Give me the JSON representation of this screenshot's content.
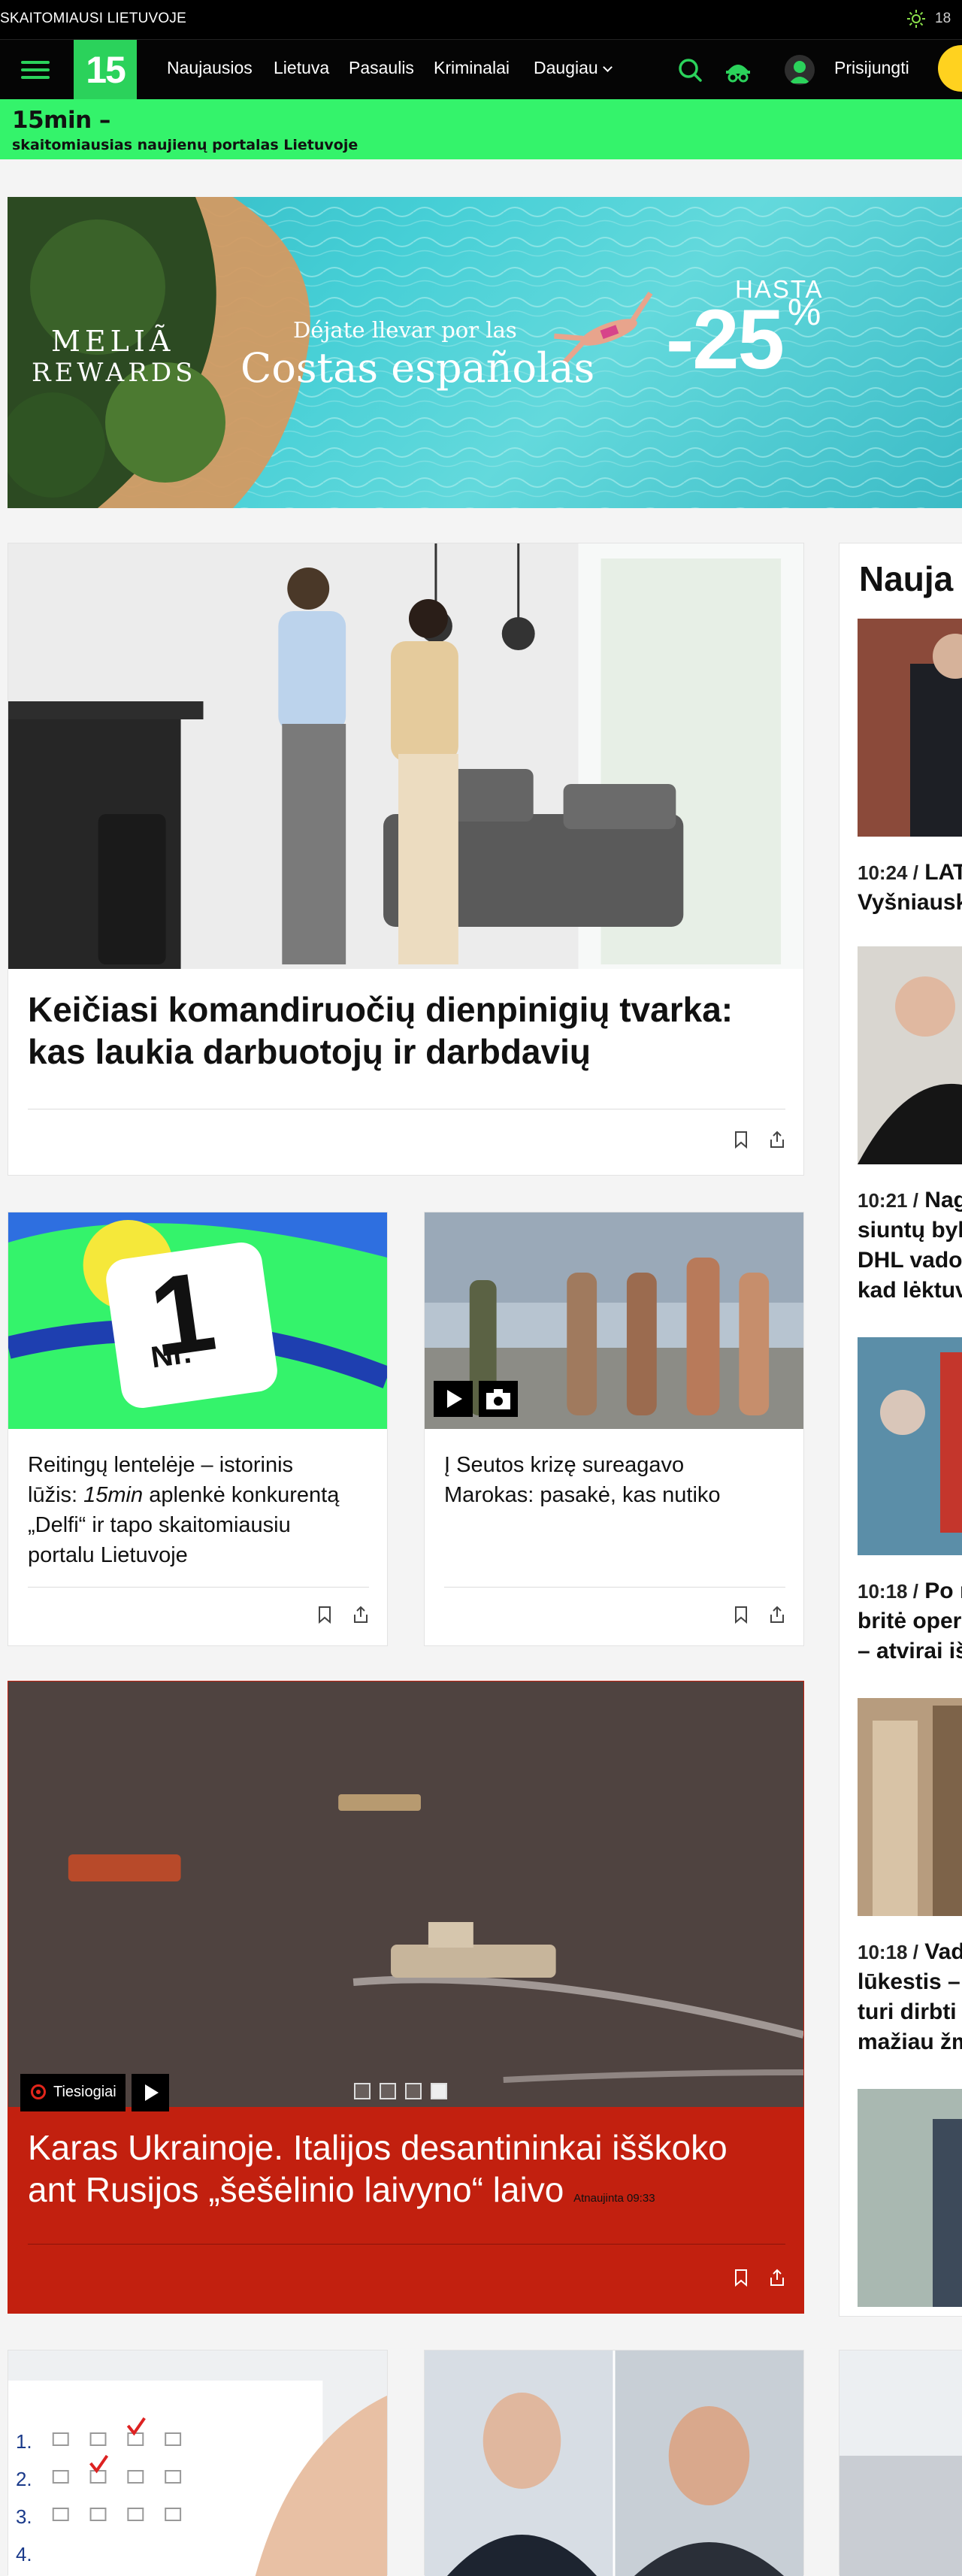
{
  "top": {
    "tagline": "SKAITOMIAUSI LIETUVOJE",
    "weather_icon": "sun-icon",
    "temperature": "18"
  },
  "nav": {
    "logo": "15",
    "links": [
      "Naujausios",
      "Lietuva",
      "Pasaulis",
      "Kriminalai",
      "Daugiau"
    ],
    "login": "Prisijungti",
    "icons": [
      "search-icon",
      "incognito-icon",
      "user-icon"
    ],
    "accent": "#2bd25b"
  },
  "slogan": {
    "line1": "15min –",
    "line2": "skaitomiausias naujienų portalas Lietuvoje",
    "color": "#34f36b"
  },
  "ad": {
    "brand_line1": "MELIÃ",
    "brand_line2": "REWARDS",
    "subtitle": "Déjate llevar por las",
    "title": "Costas españolas",
    "hasta": "HASTA",
    "discount": "-25",
    "percent": "%"
  },
  "articles": {
    "main": {
      "title_line1": "Keičiasi komandiruočių dienpinigių tvarka:",
      "title_line2": "kas laukia darbuotojų ir darbdavių"
    },
    "left": {
      "line1": "Reitingų lentelėje – istorinis",
      "line2a": "lūžis: ",
      "line2b": "15min",
      "line2c": " aplenkė konkurentą",
      "line3": "„Delfi“ ir tapo skaitomiausiu",
      "line4": "portalu Lietuvoje",
      "badge": "Nr.",
      "badge_num": "1"
    },
    "right": {
      "line1": "Į Seutos krizę sureagavo",
      "line2": "Marokas: pasakė, kas nutiko"
    },
    "live": {
      "label": "Tiesiogiai",
      "title_line1": "Karas Ukrainoje. Italijos desantininkai išškoko",
      "title_line2": "ant Rusijos „šešėlinio laivyno“ laivo",
      "updated": "Atnaujinta 09:33",
      "accent": "#c2200f"
    }
  },
  "sidebar": {
    "title": "Nauja",
    "items": [
      {
        "time": "10:24 /",
        "text1": " LAT",
        "text2": "Vyšniausk"
      },
      {
        "time": "10:21 /",
        "text1": " Nagr",
        "text2": "siuntų byl",
        "text3": "DHL vadov",
        "text4": "kad lėktuv"
      },
      {
        "time": "10:18 /",
        "text1": " Po nu",
        "text2": "britė oper",
        "text3": "– atvirai iš"
      },
      {
        "time": "10:18 /",
        "text1": " Vado",
        "text2": "lūkestis –",
        "text3": "turi dirbti",
        "text4": "mažiau žm"
      }
    ]
  }
}
